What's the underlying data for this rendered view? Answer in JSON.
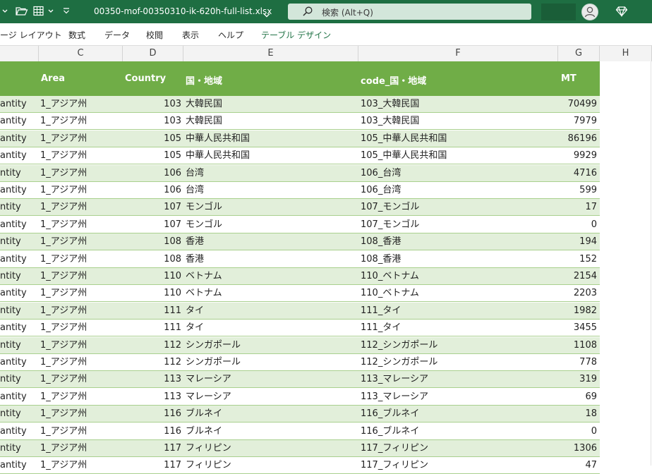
{
  "titlebar": {
    "filename": "00350-mof-00350310-ik-620h-full-list.xlsx",
    "search_placeholder": "検索 (Alt+Q)"
  },
  "ribbon": {
    "tabs": [
      "ージ レイアウト",
      "数式",
      "データ",
      "校閲",
      "表示",
      "ヘルプ",
      "テーブル デザイン"
    ],
    "active_tab": "テーブル デザイン"
  },
  "columns": [
    "C",
    "D",
    "E",
    "F",
    "G",
    "H"
  ],
  "table": {
    "headers": {
      "area": "Area",
      "country": "Country",
      "region": "国・地域",
      "code_region": "code_国・地域",
      "mt": "MT"
    },
    "rows": [
      {
        "a": "antity",
        "area": "1_アジア州",
        "code": "103",
        "name": "大韓民国",
        "codename": "103_大韓民国",
        "mt": "70499"
      },
      {
        "a": "antity",
        "area": "1_アジア州",
        "code": "103",
        "name": "大韓民国",
        "codename": "103_大韓民国",
        "mt": "7979"
      },
      {
        "a": "antity",
        "area": "1_アジア州",
        "code": "105",
        "name": "中華人民共和国",
        "codename": "105_中華人民共和国",
        "mt": "86196"
      },
      {
        "a": "antity",
        "area": "1_アジア州",
        "code": "105",
        "name": "中華人民共和国",
        "codename": "105_中華人民共和国",
        "mt": "9929"
      },
      {
        "a": "ntity",
        "area": "1_アジア州",
        "code": "106",
        "name": "台湾",
        "codename": "106_台湾",
        "mt": "4716"
      },
      {
        "a": "antity",
        "area": "1_アジア州",
        "code": "106",
        "name": "台湾",
        "codename": "106_台湾",
        "mt": "599"
      },
      {
        "a": "ntity",
        "area": "1_アジア州",
        "code": "107",
        "name": "モンゴル",
        "codename": "107_モンゴル",
        "mt": "17"
      },
      {
        "a": "antity",
        "area": "1_アジア州",
        "code": "107",
        "name": "モンゴル",
        "codename": "107_モンゴル",
        "mt": "0"
      },
      {
        "a": "ntity",
        "area": "1_アジア州",
        "code": "108",
        "name": "香港",
        "codename": "108_香港",
        "mt": "194"
      },
      {
        "a": "antity",
        "area": "1_アジア州",
        "code": "108",
        "name": "香港",
        "codename": "108_香港",
        "mt": "152"
      },
      {
        "a": "ntity",
        "area": "1_アジア州",
        "code": "110",
        "name": "ベトナム",
        "codename": "110_ベトナム",
        "mt": "2154"
      },
      {
        "a": "antity",
        "area": "1_アジア州",
        "code": "110",
        "name": "ベトナム",
        "codename": "110_ベトナム",
        "mt": "2203"
      },
      {
        "a": "ntity",
        "area": "1_アジア州",
        "code": "111",
        "name": "タイ",
        "codename": "111_タイ",
        "mt": "1982"
      },
      {
        "a": "antity",
        "area": "1_アジア州",
        "code": "111",
        "name": "タイ",
        "codename": "111_タイ",
        "mt": "3455"
      },
      {
        "a": "ntity",
        "area": "1_アジア州",
        "code": "112",
        "name": "シンガポール",
        "codename": "112_シンガポール",
        "mt": "1108"
      },
      {
        "a": "antity",
        "area": "1_アジア州",
        "code": "112",
        "name": "シンガポール",
        "codename": "112_シンガポール",
        "mt": "778"
      },
      {
        "a": "ntity",
        "area": "1_アジア州",
        "code": "113",
        "name": "マレーシア",
        "codename": "113_マレーシア",
        "mt": "319"
      },
      {
        "a": "antity",
        "area": "1_アジア州",
        "code": "113",
        "name": "マレーシア",
        "codename": "113_マレーシア",
        "mt": "69"
      },
      {
        "a": "ntity",
        "area": "1_アジア州",
        "code": "116",
        "name": "ブルネイ",
        "codename": "116_ブルネイ",
        "mt": "18"
      },
      {
        "a": "antity",
        "area": "1_アジア州",
        "code": "116",
        "name": "ブルネイ",
        "codename": "116_ブルネイ",
        "mt": "0"
      },
      {
        "a": "ntity",
        "area": "1_アジア州",
        "code": "117",
        "name": "フィリピン",
        "codename": "117_フィリピン",
        "mt": "1306"
      },
      {
        "a": "antity",
        "area": "1_アジア州",
        "code": "117",
        "name": "フィリピン",
        "codename": "117_フィリピン",
        "mt": "47"
      }
    ]
  },
  "colors": {
    "titlebar": "#1e6e42",
    "table_header": "#70ad47",
    "band": "#e2efda",
    "accent": "#217346"
  }
}
